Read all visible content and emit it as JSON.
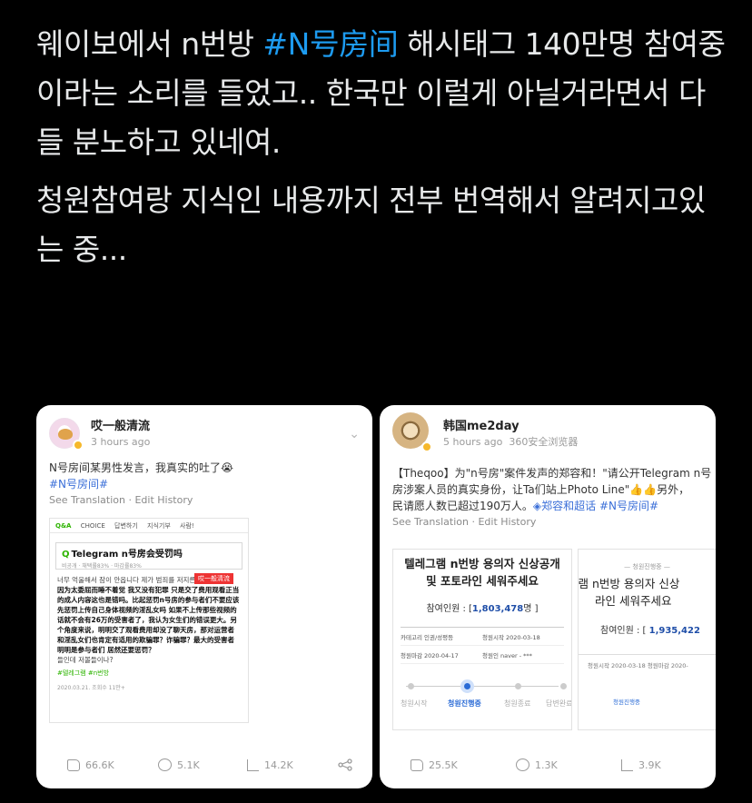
{
  "tweet": {
    "paragraph1_part1": "웨이보에서 n번방 ",
    "hashtag": "#N号房间",
    "paragraph1_part2": " 해시태그 140만명 참여중이라는 소리를 들었고.. 한국만 이럴게 아닐거라면서 다들 분노하고 있네여.",
    "paragraph2": "청원참여랑 지식인 내용까지 전부 번역해서 알려지고있는 중..."
  },
  "left_post": {
    "author": "哎一般清流",
    "time": "3 hours ago",
    "text_line1": "N号房间某男性发言，我真实的吐了😭",
    "hashtag": "#N号房间#",
    "see_translation": "See Translation",
    "edit_history": "Edit History",
    "embedded": {
      "nav": [
        "Q&A",
        "CHOICE",
        "답변하기",
        "지식기부",
        "사람!"
      ],
      "qa_title": "Telegram n号房会受罚吗",
      "qa_meta": "비공개 · 채택률83% · 마감률83%",
      "badge": "哎一般清流",
      "text_ko": "너무 억울해서 잠이 안옵니다 제가 범죄를 저지른",
      "overlay": "因为太委屈而睡不着觉 我又没有犯罪 只是交了费用观看正当的成人内容这也是错吗。比起惩罚n号房的参与者们不要应该先惩罚上传自己身体视频的淫乱女吗 如果不上传那些视频的话就不会有26万的受害者了，我认为女生们的错误更大。另个角度来说，明明交了观看费用却没了聊天房，那对运营者和淫乱女们也肯定有适用的欺骗罪？诈骗罪？最大的受害者明明是参与者们 居然还要惩罚？",
      "text_ko2": "들인데 저볼들이나?",
      "tags": "#텔레그램  #n번방",
      "footer": "2020.03.21.  조회수 11만+"
    },
    "stats": {
      "likes": "66.6K",
      "comments": "5.1K",
      "shares": "14.2K"
    }
  },
  "right_post": {
    "author": "韩国me2day",
    "time": "5 hours ago",
    "source": "360安全浏览器",
    "text_line1": "【Theqoo】为\"n号房\"案件发声的郑容和！\"请公开Telegram n号",
    "text_line2": "房涉案人员的真实身份，让Ta们站上Photo Line\"👍👍另外，",
    "text_line3_plain": "民请愿人数已超过190万人。",
    "text_line3_link": "◈郑容和超话 #N号房间#",
    "see_translation": "See Translation",
    "edit_history": "Edit History",
    "petition_a": {
      "title_line1": "텔레그램 n번방 용의자 신상공개",
      "title_line2": "및 포토라인 세워주세요",
      "count_label": "참여인원 : [",
      "count_value": "1,803,478",
      "count_suffix": "명 ]",
      "rows": [
        [
          "카테고리  인권/성평등",
          "청원시작  2020-03-18"
        ],
        [
          "청원마감  2020-04-17",
          "청원인  naver - ***"
        ]
      ],
      "steps": [
        "청원시작",
        "청원진행중",
        "청원종료",
        "답변완료"
      ],
      "active_step": 1
    },
    "petition_b": {
      "status": "— 청원진행중 —",
      "title_line1": "그램 n번방 용의자 신상",
      "title_line2": "라인 세워주세요",
      "count_label": "참여인원 : [ ",
      "count_value": "1,935,422",
      "rows": "청원시작  2020-03-18      청원마감  2020-",
      "step": "청원진행중"
    },
    "stats": {
      "likes": "25.5K",
      "comments": "1.3K",
      "shares": "3.9K"
    }
  }
}
